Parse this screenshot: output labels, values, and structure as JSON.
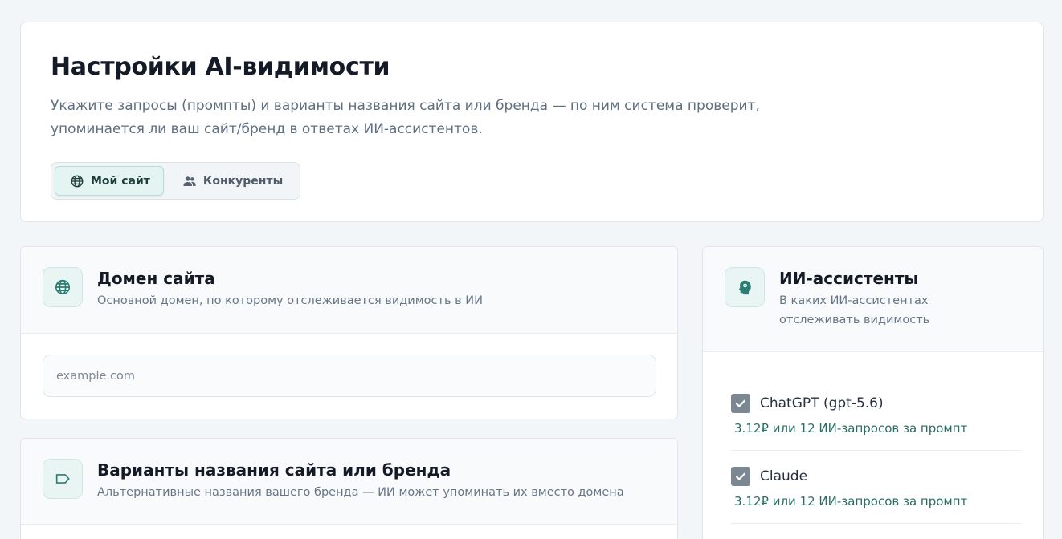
{
  "header": {
    "title": "Настройки AI-видимости",
    "description": "Укажите запросы (промпты) и варианты названия сайта или бренда — по ним система проверит, упоминается ли ваш сайт/бренд в ответах ИИ-ассистентов.",
    "tabs": [
      {
        "label": "Мой сайт",
        "icon": "globe-icon",
        "active": true
      },
      {
        "label": "Конкуренты",
        "icon": "users-icon",
        "active": false
      }
    ]
  },
  "domain": {
    "title": "Домен сайта",
    "subtitle": "Основной домен, по которому отслеживается видимость в ИИ",
    "input_value": "",
    "input_placeholder": "example.com",
    "icon": "globe-icon"
  },
  "brand": {
    "title": "Варианты названия сайта или бренда",
    "subtitle": "Альтернативные названия вашего бренда — ИИ может упоминать их вместо домена",
    "icon": "tag-icon"
  },
  "assistants": {
    "title": "ИИ-ассистенты",
    "subtitle": "В каких ИИ-ассистентах отслеживать видимость",
    "icon": "ai-head-icon",
    "items": [
      {
        "name": "ChatGPT (gpt-5.6)",
        "price": "3.12₽ или 12 ИИ-запросов за промпт",
        "checked": true
      },
      {
        "name": "Claude",
        "price": "3.12₽ или 12 ИИ-запросов за промпт",
        "checked": true
      }
    ]
  },
  "colors": {
    "accent": "#2a8a7e",
    "accent_bg": "#e4f4f1",
    "checkbox": "#7b8893"
  }
}
